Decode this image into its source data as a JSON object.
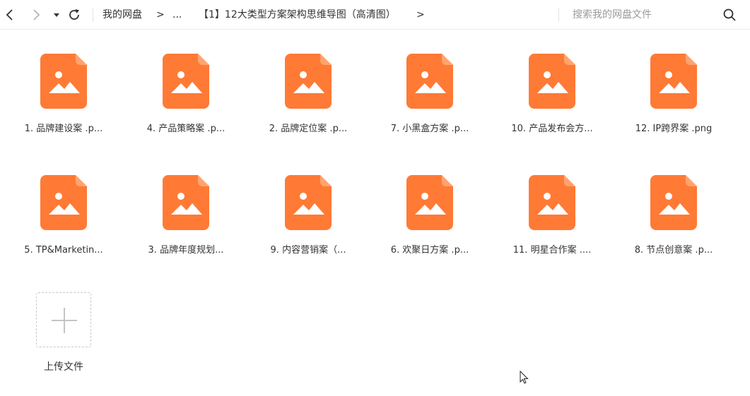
{
  "toolbar": {
    "back_icon": "chevron-left-icon",
    "forward_icon": "chevron-right-icon",
    "history_icon": "caret-down-icon",
    "refresh_icon": "refresh-icon",
    "breadcrumb": {
      "root": "我的网盘",
      "sep1": ">",
      "ellipsis": "...",
      "current": "【1】12大类型方案架构思维导图（高清图）",
      "sep2": ">"
    },
    "search_placeholder": "搜索我的网盘文件",
    "search_icon": "search-icon"
  },
  "files": [
    {
      "name": "1. 品牌建设案 .p..."
    },
    {
      "name": "4. 产品策略案 .p..."
    },
    {
      "name": "2. 品牌定位案 .p..."
    },
    {
      "name": "7. 小黑盒方案 .p..."
    },
    {
      "name": "10. 产品发布会方..."
    },
    {
      "name": "12. IP跨界案 .png"
    },
    {
      "name": "5. TP&Marketin..."
    },
    {
      "name": "3. 品牌年度规划..."
    },
    {
      "name": "9. 内容营销案（..."
    },
    {
      "name": "6. 欢聚日方案 .p..."
    },
    {
      "name": "11. 明星合作案 ...."
    },
    {
      "name": "8. 节点创意案 .p..."
    }
  ],
  "upload": {
    "label": "上传文件",
    "icon": "plus-icon"
  },
  "colors": {
    "file_icon": "#ff7a35",
    "file_icon_fold": "#ffa46e"
  }
}
